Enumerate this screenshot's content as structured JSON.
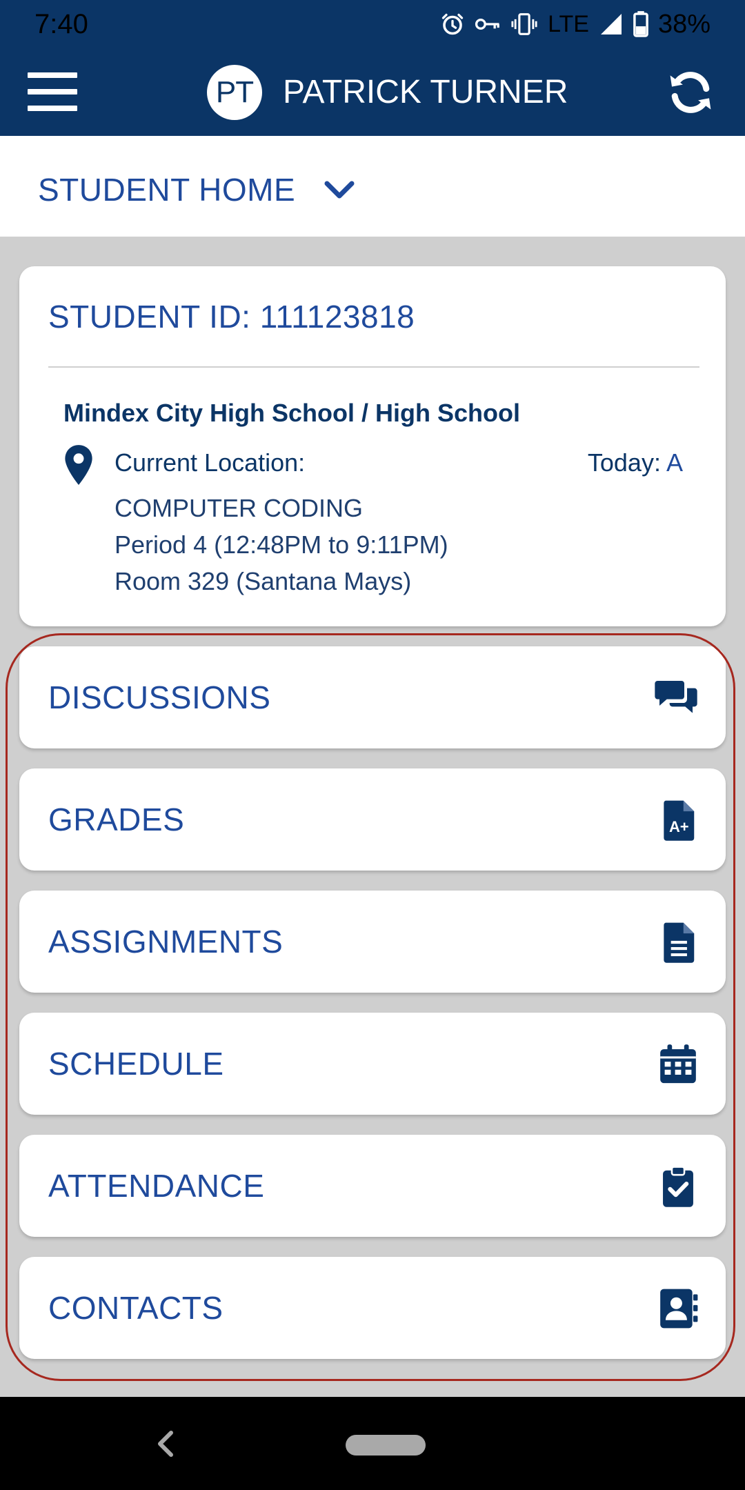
{
  "status_bar": {
    "time": "7:40",
    "network": "LTE",
    "battery": "38%"
  },
  "header": {
    "avatar_initials": "PT",
    "user_name": "PATRICK TURNER",
    "menu_icon": "hamburger-menu-icon",
    "refresh_icon": "refresh-icon",
    "bg_color": "#0b3566"
  },
  "page_select": {
    "label": "STUDENT HOME",
    "icon": "chevron-down-icon"
  },
  "student_card": {
    "student_id_label": "STUDENT ID: 111123818",
    "school": "Mindex City High School / High School",
    "location_label": "Current Location:",
    "today_label": "Today:",
    "today_value": "A",
    "course": "COMPUTER CODING",
    "period": "Period 4 (12:48PM to 9:11PM)",
    "room": "Room 329 (Santana Mays)"
  },
  "nav_items": [
    {
      "label": "DISCUSSIONS",
      "icon": "chat-bubbles-icon"
    },
    {
      "label": "GRADES",
      "icon": "grade-document-icon"
    },
    {
      "label": "ASSIGNMENTS",
      "icon": "document-icon"
    },
    {
      "label": "SCHEDULE",
      "icon": "calendar-icon"
    },
    {
      "label": "ATTENDANCE",
      "icon": "clipboard-check-icon"
    },
    {
      "label": "CONTACTS",
      "icon": "address-book-icon"
    }
  ],
  "colors": {
    "accent": "#1f4a9c",
    "dark_navy": "#0b3566",
    "background": "#cfcfcf",
    "annotation": "#a6281f"
  }
}
